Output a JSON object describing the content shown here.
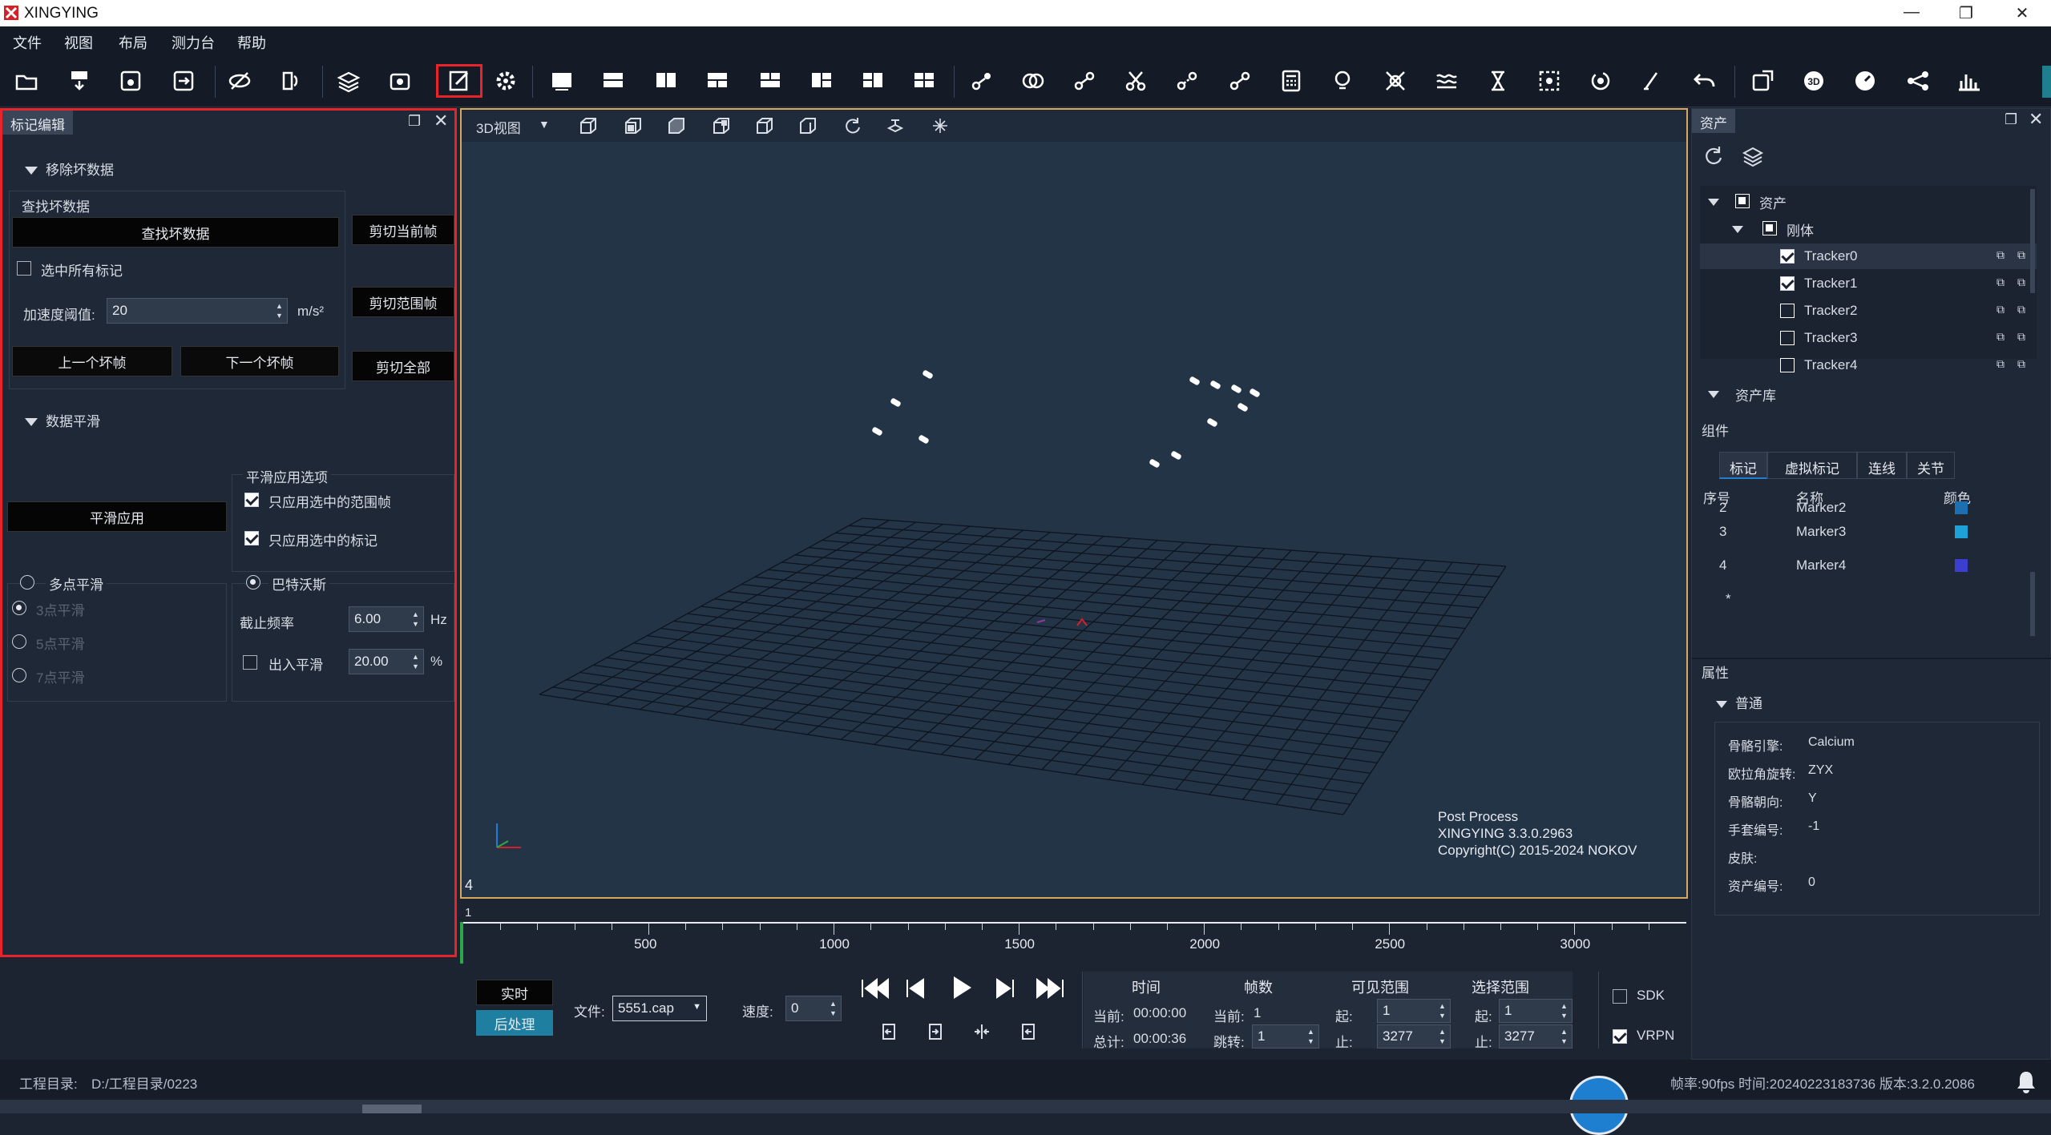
{
  "window": {
    "title": "XINGYING",
    "minimize": "—",
    "restore": "❐",
    "close": "✕"
  },
  "menu": [
    "文件",
    "视图",
    "布局",
    "测力台",
    "帮助"
  ],
  "colors": {
    "highlight": "#e8232a",
    "accent_blue": "#1e7fd0",
    "bg": "#1c2431"
  },
  "left_panel": {
    "tab": "标记编辑",
    "remove_bad": {
      "header": "移除坏数据",
      "group": "查找坏数据",
      "find_btn": "查找坏数据",
      "select_all": "选中所有标记",
      "accel_label": "加速度阈值:",
      "accel_value": "20",
      "accel_unit": "m/s²",
      "prev_btn": "上一个坏帧",
      "next_btn": "下一个坏帧",
      "cut_current": "剪切当前帧",
      "cut_range": "剪切范围帧",
      "cut_all": "剪切全部"
    },
    "smooth": {
      "header": "数据平滑",
      "options_title": "平滑应用选项",
      "opt_range": "只应用选中的范围帧",
      "opt_markers": "只应用选中的标记",
      "apply_btn": "平滑应用",
      "multipoint": "多点平滑",
      "p3": "3点平滑",
      "p5": "5点平滑",
      "p7": "7点平滑",
      "butterworth": "巴特沃斯",
      "cutoff_label": "截止频率",
      "cutoff_value": "6.00",
      "cutoff_unit": "Hz",
      "inout_label": "出入平滑",
      "inout_value": "20.00",
      "inout_unit": "%"
    }
  },
  "view3d": {
    "mode": "3D视图",
    "frame_corner": "4",
    "overlay_1": "Post Process",
    "overlay_2": "XINGYING 3.3.0.2963",
    "overlay_3": "Copyright(C) 2015-2024 NOKOV"
  },
  "timeline": {
    "start": "1",
    "ticks": [
      "500",
      "1000",
      "1500",
      "2000",
      "2500",
      "3000"
    ]
  },
  "playback": {
    "realtime": "实时",
    "post": "后处理",
    "file_label": "文件:",
    "file_value": "5551.cap",
    "speed_label": "速度:",
    "speed_value": "0",
    "time_hdr": "时间",
    "frame_hdr": "帧数",
    "visible_hdr": "可见范围",
    "select_hdr": "选择范围",
    "cur_time_label": "当前:",
    "cur_time": "00:00:00",
    "total_label": "总计:",
    "total_time": "00:00:36",
    "cur_frame_label": "当前:",
    "cur_frame": "1",
    "jump_label": "跳转:",
    "jump_value": "1",
    "start_label": "起:",
    "end_label": "止:",
    "vis_start": "1",
    "vis_end": "3277",
    "sel_start": "1",
    "sel_end": "3277",
    "sdk": "SDK",
    "vrpn": "VRPN"
  },
  "right_panel": {
    "tab": "资产",
    "tree": {
      "root": "资产",
      "rigid": "刚体",
      "trackers": [
        {
          "name": "Tracker0",
          "checked": true
        },
        {
          "name": "Tracker1",
          "checked": true
        },
        {
          "name": "Tracker2",
          "checked": false
        },
        {
          "name": "Tracker3",
          "checked": false
        },
        {
          "name": "Tracker4",
          "checked": false
        }
      ],
      "library": "资产库"
    },
    "components_label": "组件",
    "comp_tabs": [
      "标记",
      "虚拟标记",
      "连线",
      "关节"
    ],
    "table_headers": [
      "序号",
      "名称",
      "颜色"
    ],
    "rows": [
      {
        "idx": "2",
        "name": "Marker2",
        "color": "#1c6fb0"
      },
      {
        "idx": "3",
        "name": "Marker3",
        "color": "#1ea0d8"
      },
      {
        "idx": "4",
        "name": "Marker4",
        "color": "#3a3fd0"
      }
    ],
    "row_star": "*",
    "props_label": "属性",
    "general": "普通",
    "props": [
      {
        "k": "骨骼引擎:",
        "v": "Calcium"
      },
      {
        "k": "欧拉角旋转:",
        "v": "ZYX"
      },
      {
        "k": "骨骼朝向:",
        "v": "Y"
      },
      {
        "k": "手套编号:",
        "v": "-1"
      },
      {
        "k": "皮肤:",
        "v": ""
      },
      {
        "k": "资产编号:",
        "v": "0"
      }
    ]
  },
  "status": {
    "project_label": "工程目录:",
    "project_path": "D:/工程目录/0223",
    "info": "帧率:90fps 时间:20240223183736 版本:3.2.0.2086"
  }
}
